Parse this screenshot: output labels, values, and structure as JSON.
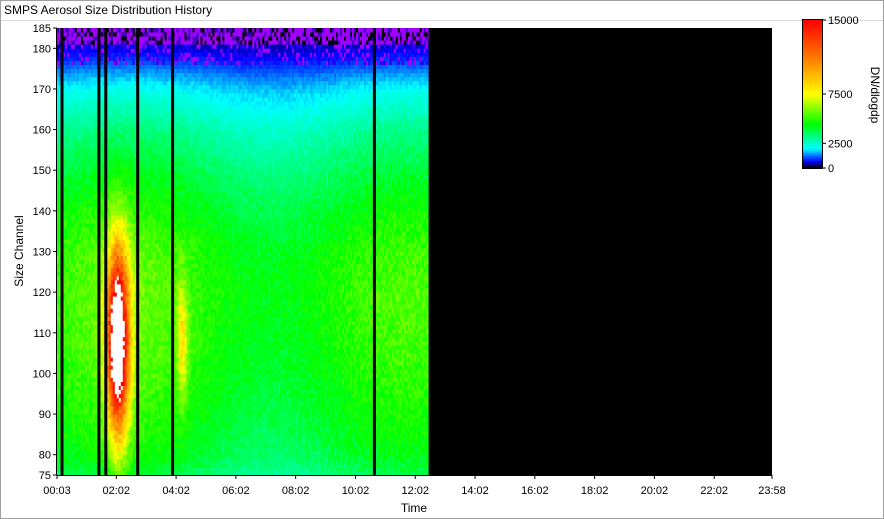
{
  "window": {
    "title": "SMPS Aerosol Size Distribution History"
  },
  "chart_data": {
    "type": "heatmap",
    "title": "",
    "xlabel": "Time",
    "ylabel": "Size Channel",
    "x_ticks": [
      "00:03",
      "02:02",
      "04:02",
      "06:02",
      "08:02",
      "10:02",
      "12:02",
      "14:02",
      "16:02",
      "18:02",
      "20:02",
      "22:02",
      "23:58"
    ],
    "y_ticks": [
      75,
      80,
      90,
      100,
      110,
      120,
      130,
      140,
      150,
      160,
      170,
      180,
      185
    ],
    "xlim": [
      "00:03",
      "23:58"
    ],
    "ylim": [
      75,
      185
    ],
    "data_end_time": "12:28",
    "colorbar": {
      "label": "DN/dlogdp",
      "ticks": [
        0,
        2500,
        7500,
        15000
      ],
      "range": [
        0,
        15000
      ],
      "stops": [
        {
          "value": 0,
          "color": "#000000"
        },
        {
          "value": 700,
          "color": "#0000ff"
        },
        {
          "value": 2000,
          "color": "#00ffff"
        },
        {
          "value": 4500,
          "color": "#00ff00"
        },
        {
          "value": 7500,
          "color": "#ffff00"
        },
        {
          "value": 11000,
          "color": "#ff8000"
        },
        {
          "value": 15000,
          "color": "#ff0000"
        }
      ],
      "over_color": "#ffffff",
      "top_channel_color": "#a000ff"
    },
    "gap_lines": [
      "00:13",
      "01:27",
      "01:41",
      "02:45",
      "03:55",
      "10:40"
    ],
    "profile": {
      "channels": [
        75,
        80,
        90,
        100,
        110,
        120,
        130,
        140,
        150,
        160,
        165,
        170,
        174,
        178,
        182,
        185
      ],
      "values": [
        3600,
        4200,
        4600,
        4900,
        5100,
        5200,
        5000,
        4500,
        3800,
        3000,
        2500,
        2000,
        1400,
        800,
        400,
        200
      ]
    },
    "events": [
      {
        "name": "plume",
        "center_time": "02:05",
        "center_channel": 108,
        "peak": 14000,
        "time_width_min": 22,
        "channel_width": 22
      },
      {
        "name": "secondary",
        "center_time": "04:15",
        "center_channel": 108,
        "peak": 3200,
        "time_width_min": 10,
        "channel_width": 14
      }
    ]
  }
}
